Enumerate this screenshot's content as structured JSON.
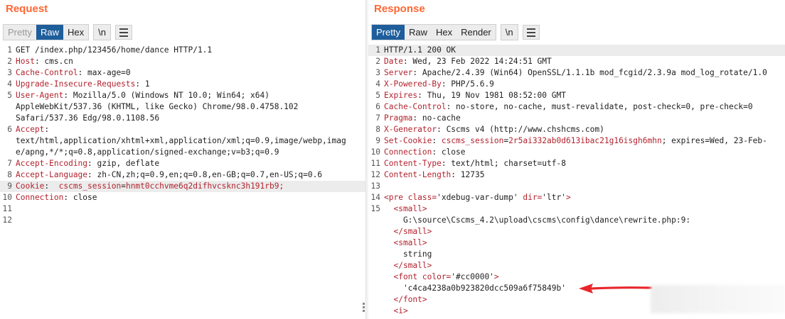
{
  "request": {
    "title": "Request",
    "tabs": [
      {
        "label": "Pretty",
        "state": "disabled"
      },
      {
        "label": "Raw",
        "state": "active"
      },
      {
        "label": "Hex",
        "state": "normal"
      }
    ],
    "newline_label": "\\n",
    "lines": [
      {
        "n": "1",
        "parts": [
          {
            "t": "GET /index.php/123456/home/dance HTTP/1.1",
            "c": "v"
          }
        ]
      },
      {
        "n": "2",
        "parts": [
          {
            "t": "Host",
            "c": "k"
          },
          {
            "t": ": cms.cn",
            "c": "v"
          }
        ]
      },
      {
        "n": "3",
        "parts": [
          {
            "t": "Cache-Control",
            "c": "k"
          },
          {
            "t": ": max-age=0",
            "c": "v"
          }
        ]
      },
      {
        "n": "4",
        "parts": [
          {
            "t": "Upgrade-Insecure-Requests",
            "c": "k"
          },
          {
            "t": ": 1",
            "c": "v"
          }
        ]
      },
      {
        "n": "5",
        "parts": [
          {
            "t": "User-Agent",
            "c": "k"
          },
          {
            "t": ": Mozilla/5.0 (Windows NT 10.0; Win64; x64)",
            "c": "v"
          }
        ]
      },
      {
        "n": "",
        "parts": [
          {
            "t": "AppleWebKit/537.36 (KHTML, like Gecko) Chrome/98.0.4758.102",
            "c": "v"
          }
        ]
      },
      {
        "n": "",
        "parts": [
          {
            "t": "Safari/537.36 Edg/98.0.1108.56",
            "c": "v"
          }
        ]
      },
      {
        "n": "6",
        "parts": [
          {
            "t": "Accept",
            "c": "k"
          },
          {
            "t": ":",
            "c": "v"
          }
        ]
      },
      {
        "n": "",
        "parts": [
          {
            "t": "text/html,application/xhtml+xml,application/xml;q=0.9,image/webp,imag",
            "c": "v"
          }
        ]
      },
      {
        "n": "",
        "parts": [
          {
            "t": "e/apng,*/*;q=0.8,application/signed-exchange;v=b3;q=0.9",
            "c": "v"
          }
        ]
      },
      {
        "n": "7",
        "parts": [
          {
            "t": "Accept-Encoding",
            "c": "k"
          },
          {
            "t": ": gzip, deflate",
            "c": "v"
          }
        ]
      },
      {
        "n": "8",
        "parts": [
          {
            "t": "Accept-Language",
            "c": "k"
          },
          {
            "t": ": zh-CN,zh;q=0.9,en;q=0.8,en-GB;q=0.7,en-US;q=0.6",
            "c": "v"
          }
        ]
      },
      {
        "n": "9",
        "hl": true,
        "parts": [
          {
            "t": "Cookie",
            "c": "k"
          },
          {
            "t": ":  ",
            "c": "v"
          },
          {
            "t": "cscms_session",
            "c": "k"
          },
          {
            "t": "=",
            "c": "v"
          },
          {
            "t": "hnmt0cchvme6q2difhvcsknc3h191rb9;",
            "c": "cv"
          }
        ]
      },
      {
        "n": "10",
        "parts": [
          {
            "t": "Connection",
            "c": "k"
          },
          {
            "t": ": close",
            "c": "v"
          }
        ]
      },
      {
        "n": "11",
        "parts": []
      },
      {
        "n": "12",
        "parts": []
      }
    ]
  },
  "response": {
    "title": "Response",
    "tabs": [
      {
        "label": "Pretty",
        "state": "active"
      },
      {
        "label": "Raw",
        "state": "normal"
      },
      {
        "label": "Hex",
        "state": "normal"
      },
      {
        "label": "Render",
        "state": "normal"
      }
    ],
    "newline_label": "\\n",
    "lines": [
      {
        "n": "1",
        "hl": true,
        "parts": [
          {
            "t": "HTTP/1.1 200 OK",
            "c": "v"
          }
        ]
      },
      {
        "n": "2",
        "parts": [
          {
            "t": "Date",
            "c": "k"
          },
          {
            "t": ": Wed, 23 Feb 2022 14:24:51 GMT",
            "c": "v"
          }
        ]
      },
      {
        "n": "3",
        "parts": [
          {
            "t": "Server",
            "c": "k"
          },
          {
            "t": ": Apache/2.4.39 (Win64) OpenSSL/1.1.1b mod_fcgid/2.3.9a mod_log_rotate/1.0",
            "c": "v"
          }
        ]
      },
      {
        "n": "4",
        "parts": [
          {
            "t": "X-Powered-By",
            "c": "k"
          },
          {
            "t": ": PHP/5.6.9",
            "c": "v"
          }
        ]
      },
      {
        "n": "5",
        "parts": [
          {
            "t": "Expires",
            "c": "k"
          },
          {
            "t": ": Thu, 19 Nov 1981 08:52:00 GMT",
            "c": "v"
          }
        ]
      },
      {
        "n": "6",
        "parts": [
          {
            "t": "Cache-Control",
            "c": "k"
          },
          {
            "t": ": no-store, no-cache, must-revalidate, post-check=0, pre-check=0",
            "c": "v"
          }
        ]
      },
      {
        "n": "7",
        "parts": [
          {
            "t": "Pragma",
            "c": "k"
          },
          {
            "t": ": no-cache",
            "c": "v"
          }
        ]
      },
      {
        "n": "8",
        "parts": [
          {
            "t": "X-Generator",
            "c": "k"
          },
          {
            "t": ": Cscms v4 (http://www.chshcms.com)",
            "c": "v"
          }
        ]
      },
      {
        "n": "9",
        "parts": [
          {
            "t": "Set-Cookie",
            "c": "k"
          },
          {
            "t": ": ",
            "c": "v"
          },
          {
            "t": "cscms_session",
            "c": "k"
          },
          {
            "t": "=",
            "c": "v"
          },
          {
            "t": "2r5ai332ab0d613ibac21g16isgh6mhn",
            "c": "cv"
          },
          {
            "t": "; expires=Wed, 23-Feb-",
            "c": "v"
          }
        ]
      },
      {
        "n": "10",
        "parts": [
          {
            "t": "Connection",
            "c": "k"
          },
          {
            "t": ": close",
            "c": "v"
          }
        ]
      },
      {
        "n": "11",
        "parts": [
          {
            "t": "Content-Type",
            "c": "k"
          },
          {
            "t": ": text/html; charset=utf-8",
            "c": "v"
          }
        ]
      },
      {
        "n": "12",
        "parts": [
          {
            "t": "Content-Length",
            "c": "k"
          },
          {
            "t": ": 12735",
            "c": "v"
          }
        ]
      },
      {
        "n": "13",
        "parts": []
      },
      {
        "n": "14",
        "parts": [
          {
            "t": "<pre class=",
            "c": "tag"
          },
          {
            "t": "'xdebug-var-dump'",
            "c": "attrv"
          },
          {
            "t": " dir=",
            "c": "tag"
          },
          {
            "t": "'ltr'",
            "c": "attrv"
          },
          {
            "t": ">",
            "c": "tag"
          }
        ]
      },
      {
        "n": "15",
        "parts": [
          {
            "t": "  <small>",
            "c": "tag"
          }
        ]
      },
      {
        "n": "",
        "parts": [
          {
            "t": "    G:\\source\\Cscms_4.2\\upload\\cscms\\config\\dance\\rewrite.php:9:",
            "c": "v"
          }
        ]
      },
      {
        "n": "",
        "parts": [
          {
            "t": "  </small>",
            "c": "tag"
          }
        ]
      },
      {
        "n": "",
        "parts": [
          {
            "t": "  <small>",
            "c": "tag"
          }
        ]
      },
      {
        "n": "",
        "parts": [
          {
            "t": "    string",
            "c": "v"
          }
        ]
      },
      {
        "n": "",
        "parts": [
          {
            "t": "  </small>",
            "c": "tag"
          }
        ]
      },
      {
        "n": "",
        "parts": [
          {
            "t": "  <font color=",
            "c": "tag"
          },
          {
            "t": "'#cc0000'",
            "c": "attrv"
          },
          {
            "t": ">",
            "c": "tag"
          }
        ]
      },
      {
        "n": "",
        "parts": [
          {
            "t": "    'c4ca4238a0b923820dcc509a6f75849b'",
            "c": "v"
          }
        ]
      },
      {
        "n": "",
        "parts": [
          {
            "t": "  </font>",
            "c": "tag"
          }
        ]
      },
      {
        "n": "",
        "parts": [
          {
            "t": "  <i>",
            "c": "tag"
          }
        ]
      }
    ]
  },
  "icons": {
    "menu": "hamburger-menu-icon",
    "arrow": "red-arrow-annotation"
  },
  "colors": {
    "accent": "#ff6633",
    "active_tab": "#1e5e9b",
    "key": "#b2232e"
  }
}
